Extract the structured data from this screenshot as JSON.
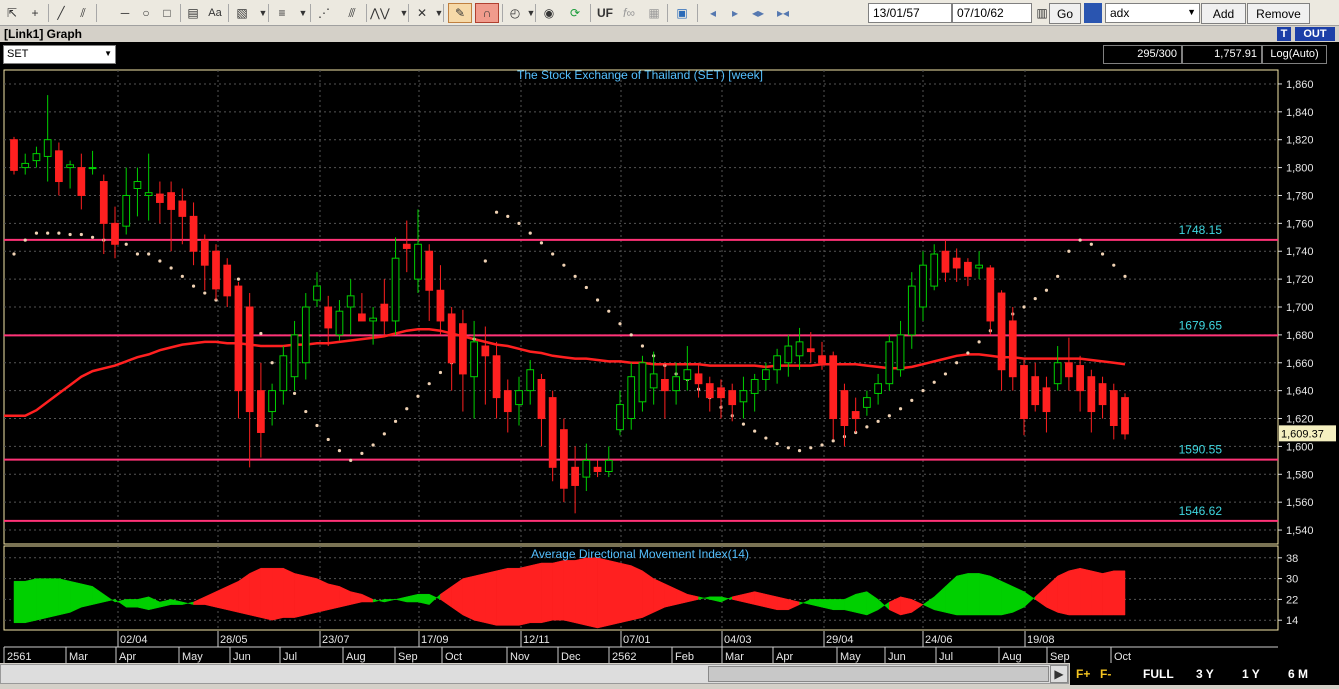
{
  "toolbar": {
    "start_date": "13/01/57",
    "end_date": "07/10/62",
    "go_label": "Go",
    "indicator_value": "adx",
    "add_label": "Add",
    "remove_label": "Remove",
    "uf_label": "UF",
    "fx_label": "f∞",
    "aa_label": "Aa"
  },
  "window": {
    "title": "[Link1] Graph",
    "t_label": "T",
    "out_label": "OUT"
  },
  "info": {
    "symbol": "SET",
    "bars": "295/300",
    "last_value": "1,757.91",
    "scale": "Log(Auto)"
  },
  "chart_data": [
    {
      "type": "candlestick",
      "title": "The Stock Exchange of Thailand (SET) [week]",
      "ylim": [
        1530,
        1870
      ],
      "yticks": [
        "1,540",
        "1,560",
        "1,580",
        "1,600",
        "1,620",
        "1,640",
        "1,660",
        "1,680",
        "1,700",
        "1,720",
        "1,740",
        "1,760",
        "1,780",
        "1,800",
        "1,820",
        "1,840",
        "1,860"
      ],
      "current_price": "1,609.37",
      "levels": [
        {
          "value": 1748.15,
          "label": "1748.15"
        },
        {
          "value": 1679.65,
          "label": "1679.65"
        },
        {
          "value": 1590.55,
          "label": "1590.55"
        },
        {
          "value": 1546.62,
          "label": "1546.62"
        }
      ],
      "ohlc": [
        [
          1820,
          1822,
          1795,
          1798
        ],
        [
          1800,
          1810,
          1795,
          1803
        ],
        [
          1805,
          1815,
          1800,
          1810
        ],
        [
          1808,
          1852,
          1790,
          1820
        ],
        [
          1812,
          1818,
          1780,
          1790
        ],
        [
          1800,
          1805,
          1785,
          1802
        ],
        [
          1800,
          1810,
          1770,
          1780
        ],
        [
          1800,
          1812,
          1795,
          1800
        ],
        [
          1790,
          1795,
          1738,
          1760
        ],
        [
          1760,
          1772,
          1735,
          1745
        ],
        [
          1758,
          1800,
          1752,
          1780
        ],
        [
          1785,
          1800,
          1765,
          1790
        ],
        [
          1780,
          1810,
          1762,
          1782
        ],
        [
          1781,
          1790,
          1760,
          1775
        ],
        [
          1782,
          1790,
          1740,
          1770
        ],
        [
          1776,
          1785,
          1745,
          1765
        ],
        [
          1765,
          1775,
          1730,
          1740
        ],
        [
          1748,
          1752,
          1712,
          1730
        ],
        [
          1740,
          1745,
          1705,
          1713
        ],
        [
          1730,
          1735,
          1700,
          1708
        ],
        [
          1715,
          1718,
          1620,
          1640
        ],
        [
          1700,
          1710,
          1585,
          1625
        ],
        [
          1640,
          1660,
          1592,
          1610
        ],
        [
          1625,
          1645,
          1615,
          1640
        ],
        [
          1640,
          1672,
          1630,
          1665
        ],
        [
          1650,
          1690,
          1640,
          1680
        ],
        [
          1660,
          1710,
          1648,
          1700
        ],
        [
          1705,
          1725,
          1700,
          1715
        ],
        [
          1700,
          1708,
          1672,
          1685
        ],
        [
          1680,
          1705,
          1676,
          1697
        ],
        [
          1700,
          1720,
          1680,
          1708
        ],
        [
          1695,
          1710,
          1690,
          1690
        ],
        [
          1690,
          1700,
          1673,
          1692
        ],
        [
          1702,
          1720,
          1680,
          1690
        ],
        [
          1690,
          1750,
          1680,
          1735
        ],
        [
          1745,
          1762,
          1725,
          1742
        ],
        [
          1720,
          1770,
          1710,
          1745
        ],
        [
          1740,
          1745,
          1690,
          1712
        ],
        [
          1712,
          1730,
          1680,
          1690
        ],
        [
          1695,
          1700,
          1640,
          1660
        ],
        [
          1688,
          1698,
          1625,
          1652
        ],
        [
          1650,
          1690,
          1620,
          1675
        ],
        [
          1672,
          1686,
          1630,
          1665
        ],
        [
          1665,
          1675,
          1620,
          1635
        ],
        [
          1640,
          1648,
          1610,
          1625
        ],
        [
          1630,
          1650,
          1615,
          1640
        ],
        [
          1640,
          1662,
          1630,
          1655
        ],
        [
          1648,
          1652,
          1600,
          1620
        ],
        [
          1635,
          1640,
          1575,
          1585
        ],
        [
          1612,
          1620,
          1560,
          1570
        ],
        [
          1585,
          1600,
          1552,
          1572
        ],
        [
          1578,
          1602,
          1568,
          1590
        ],
        [
          1585,
          1590,
          1578,
          1582
        ],
        [
          1582,
          1600,
          1578,
          1590
        ],
        [
          1612,
          1640,
          1608,
          1630
        ],
        [
          1620,
          1660,
          1612,
          1650
        ],
        [
          1632,
          1665,
          1625,
          1660
        ],
        [
          1642,
          1668,
          1630,
          1652
        ],
        [
          1648,
          1660,
          1620,
          1640
        ],
        [
          1640,
          1660,
          1630,
          1650
        ],
        [
          1648,
          1672,
          1640,
          1655
        ],
        [
          1652,
          1660,
          1635,
          1645
        ],
        [
          1645,
          1650,
          1625,
          1635
        ],
        [
          1642,
          1648,
          1620,
          1635
        ],
        [
          1640,
          1645,
          1618,
          1630
        ],
        [
          1632,
          1650,
          1620,
          1640
        ],
        [
          1638,
          1652,
          1625,
          1648
        ],
        [
          1648,
          1660,
          1640,
          1655
        ],
        [
          1655,
          1670,
          1645,
          1665
        ],
        [
          1660,
          1680,
          1650,
          1672
        ],
        [
          1665,
          1685,
          1655,
          1675
        ],
        [
          1670,
          1682,
          1660,
          1668
        ],
        [
          1665,
          1675,
          1655,
          1660
        ],
        [
          1665,
          1668,
          1605,
          1620
        ],
        [
          1640,
          1645,
          1600,
          1615
        ],
        [
          1625,
          1635,
          1610,
          1620
        ],
        [
          1628,
          1640,
          1622,
          1635
        ],
        [
          1638,
          1652,
          1630,
          1645
        ],
        [
          1645,
          1680,
          1640,
          1675
        ],
        [
          1655,
          1690,
          1650,
          1680
        ],
        [
          1680,
          1725,
          1670,
          1715
        ],
        [
          1700,
          1740,
          1690,
          1730
        ],
        [
          1715,
          1745,
          1712,
          1738
        ],
        [
          1740,
          1748,
          1718,
          1725
        ],
        [
          1735,
          1742,
          1718,
          1728
        ],
        [
          1732,
          1735,
          1715,
          1722
        ],
        [
          1728,
          1740,
          1720,
          1730
        ],
        [
          1728,
          1730,
          1680,
          1690
        ],
        [
          1710,
          1712,
          1640,
          1655
        ],
        [
          1690,
          1700,
          1640,
          1650
        ],
        [
          1658,
          1662,
          1608,
          1620
        ],
        [
          1650,
          1660,
          1625,
          1630
        ],
        [
          1642,
          1650,
          1610,
          1625
        ],
        [
          1645,
          1672,
          1640,
          1660
        ],
        [
          1660,
          1678,
          1640,
          1650
        ],
        [
          1658,
          1665,
          1625,
          1640
        ],
        [
          1650,
          1655,
          1610,
          1625
        ],
        [
          1645,
          1650,
          1620,
          1630
        ],
        [
          1640,
          1645,
          1605,
          1615
        ],
        [
          1635,
          1638,
          1605,
          1609
        ]
      ],
      "ma": [
        1622,
        1622,
        1626,
        1632,
        1638,
        1644,
        1650,
        1654,
        1656,
        1658,
        1661,
        1664,
        1666,
        1669,
        1671,
        1673,
        1674,
        1675,
        1675,
        1674,
        1674,
        1673,
        1672,
        1672,
        1672,
        1673,
        1673,
        1674,
        1674,
        1675,
        1676,
        1677,
        1678,
        1679,
        1681,
        1683,
        1684,
        1684,
        1683,
        1681,
        1679,
        1677,
        1675,
        1673,
        1672,
        1670,
        1668,
        1667,
        1665,
        1664,
        1663,
        1663,
        1662,
        1661,
        1661,
        1660,
        1660,
        1659,
        1659,
        1659,
        1659,
        1659,
        1658,
        1658,
        1658,
        1658,
        1658,
        1657,
        1658,
        1658,
        1658,
        1658,
        1659,
        1659,
        1659,
        1659,
        1658,
        1657,
        1656,
        1656,
        1657,
        1659,
        1661,
        1663,
        1665,
        1666,
        1666,
        1665,
        1664,
        1664,
        1663,
        1663,
        1663,
        1663,
        1663,
        1663,
        1662,
        1661,
        1660,
        1659
      ],
      "sar": [
        1738,
        1748,
        1753,
        1753,
        1753,
        1752,
        1752,
        1750,
        1748,
        1746,
        1745,
        1738,
        1738,
        1733,
        1728,
        1722,
        1715,
        1710,
        1705,
        1712,
        1720,
        1690,
        1681,
        1660,
        1650,
        1638,
        1625,
        1615,
        1605,
        1597,
        1590,
        1595,
        1601,
        1609,
        1618,
        1627,
        1636,
        1645,
        1653,
        1660,
        1662,
        1677,
        1733,
        1768,
        1765,
        1760,
        1753,
        1746,
        1738,
        1730,
        1722,
        1714,
        1705,
        1697,
        1688,
        1680,
        1672,
        1665,
        1658,
        1652,
        1648,
        1641,
        1635,
        1628,
        1622,
        1616,
        1611,
        1606,
        1602,
        1599,
        1597,
        1599,
        1601,
        1604,
        1607,
        1610,
        1614,
        1618,
        1622,
        1627,
        1633,
        1640,
        1646,
        1652,
        1660,
        1667,
        1675,
        1683,
        1689,
        1695,
        1700,
        1706,
        1712,
        1722,
        1740,
        1748,
        1745,
        1738,
        1730,
        1722
      ]
    },
    {
      "type": "area",
      "title": "Average Directional Movement Index(14)",
      "ylim": [
        11,
        41
      ],
      "yticks": [
        "14",
        "22",
        "30",
        "38"
      ],
      "x_labels_top": [
        "02/04",
        "28/05",
        "23/07",
        "17/09",
        "12/11",
        "07/01",
        "04/03",
        "29/04",
        "24/06",
        "19/08"
      ],
      "x_labels_bottom": [
        "2561",
        "Mar",
        "Apr",
        "May",
        "Jun",
        "Jul",
        "Aug",
        "Sep",
        "Oct",
        "Nov",
        "Dec",
        "2562",
        "Feb",
        "Mar",
        "Apr",
        "May",
        "Jun",
        "Jul",
        "Aug",
        "Sep",
        "Oct"
      ],
      "di_plus": [
        29,
        29,
        30,
        30,
        30,
        29,
        28,
        27,
        24,
        21,
        22,
        22,
        23,
        21,
        22,
        21,
        20,
        20,
        19,
        18,
        17,
        16,
        15,
        14,
        15,
        15,
        16,
        17,
        18,
        19,
        20,
        21,
        21,
        22,
        22,
        23,
        24,
        24,
        22,
        19,
        16,
        14,
        13,
        12,
        12,
        12,
        13,
        13,
        14,
        14,
        13,
        12,
        11,
        12,
        13,
        14,
        15,
        17,
        19,
        20,
        21,
        22,
        23,
        23,
        22,
        21,
        20,
        19,
        18,
        18,
        20,
        22,
        22,
        22,
        22,
        24,
        25,
        22,
        18,
        16,
        17,
        20,
        23,
        27,
        31,
        32,
        32,
        31,
        29,
        27,
        25,
        22,
        19,
        17,
        16,
        16,
        16,
        16,
        16,
        16
      ],
      "di_minus": [
        13,
        13,
        14,
        15,
        16,
        17,
        19,
        20,
        21,
        22,
        19,
        19,
        18,
        19,
        20,
        20,
        21,
        23,
        25,
        27,
        29,
        32,
        34,
        34,
        34,
        32,
        31,
        30,
        28,
        27,
        25,
        24,
        22,
        21,
        22,
        21,
        21,
        20,
        24,
        27,
        30,
        31,
        32,
        33,
        34,
        34,
        35,
        36,
        36,
        37,
        37,
        38,
        38,
        37,
        36,
        35,
        33,
        30,
        28,
        26,
        24,
        23,
        22,
        21,
        23,
        24,
        25,
        24,
        23,
        22,
        21,
        20,
        19,
        18,
        18,
        17,
        16,
        18,
        21,
        23,
        22,
        20,
        18,
        17,
        16,
        16,
        16,
        16,
        16,
        17,
        19,
        23,
        27,
        31,
        33,
        34,
        33,
        32,
        33,
        33
      ]
    }
  ],
  "bottom": {
    "full_label": "FULL",
    "y3_label": "3 Y",
    "y1_label": "1 Y",
    "m6_label": "6 M",
    "f_plus": "F+",
    "f_minus": "F-"
  },
  "colors": {
    "up": "#00d000",
    "down": "#ff2020",
    "ma": "#ff2020",
    "level": "#ff3377",
    "sar": "#f0d2b4",
    "axis": "#e6e6e6",
    "title_text": "#55c0ff",
    "level_text": "#3fd7e0"
  }
}
